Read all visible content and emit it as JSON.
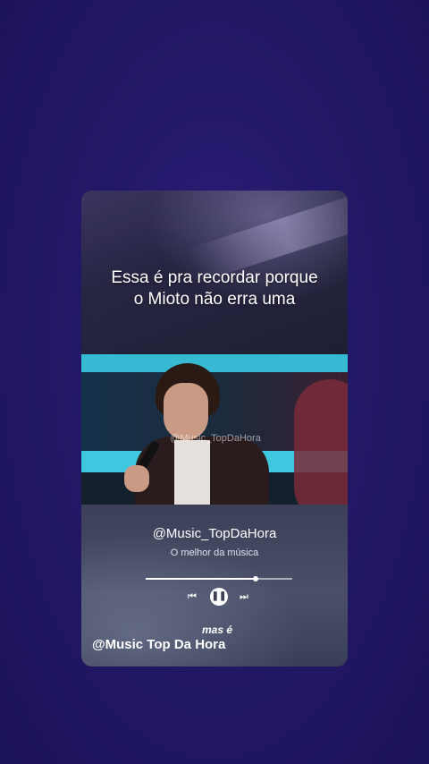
{
  "post": {
    "headline_line1": "Essa é pra recordar porque",
    "headline_line2": "o Mioto não erra uma",
    "video_watermark": "@Music_TopDaHora"
  },
  "player": {
    "username": "@Music_TopDaHora",
    "subtitle": "O melhor da música",
    "progress": 0.75,
    "prev_icon": "skip-previous-icon",
    "play_icon": "pause-icon",
    "next_icon": "skip-next-icon",
    "prev_glyph": "⏮",
    "pause_glyph": "❚❚",
    "next_glyph": "⏭"
  },
  "caption": {
    "small_text": "mas é",
    "channel_text": "@Music Top Da Hora"
  }
}
